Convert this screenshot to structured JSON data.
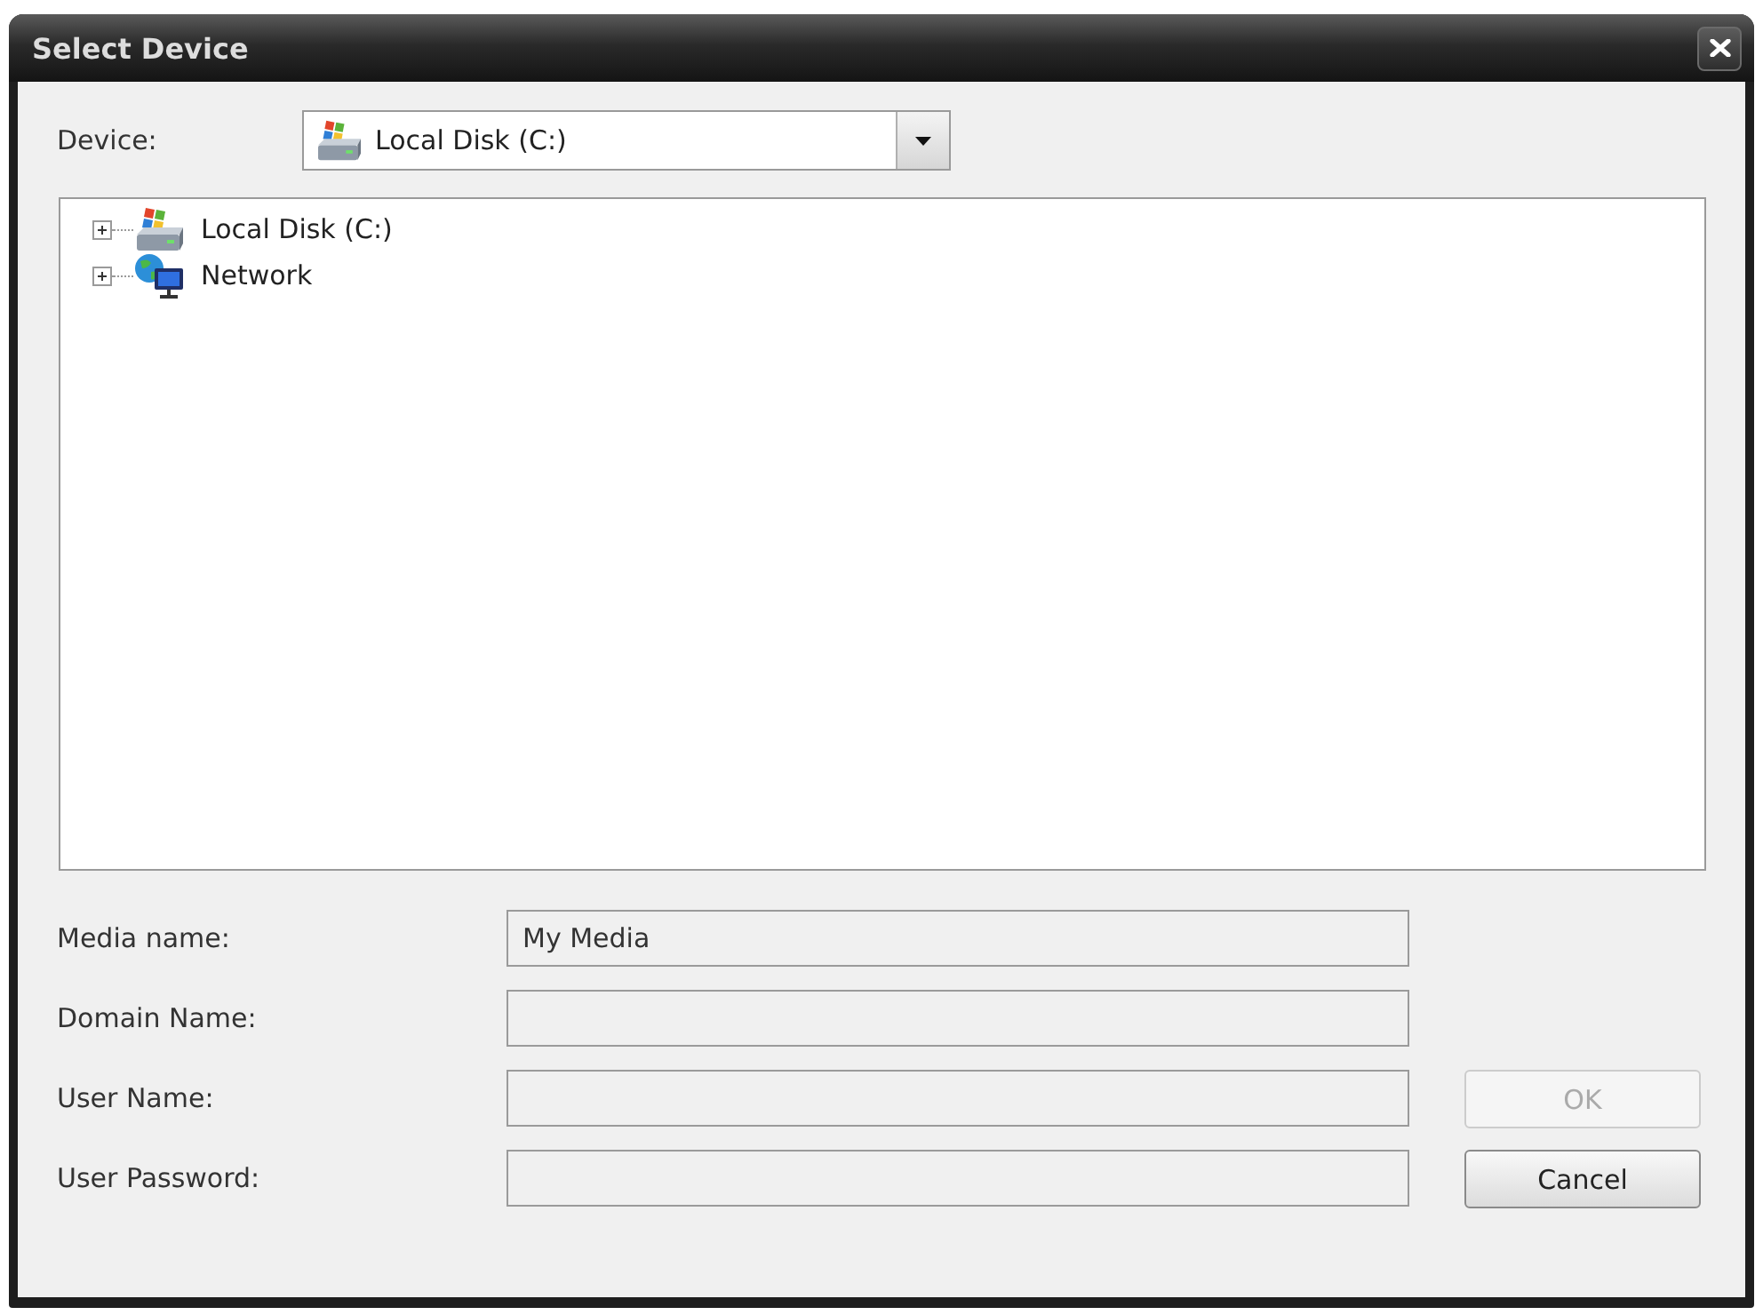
{
  "window": {
    "title": "Select Device"
  },
  "device": {
    "label": "Device:",
    "value": "Local Disk (C:)"
  },
  "tree": {
    "items": [
      {
        "label": "Local Disk (C:)",
        "kind": "drive",
        "expanded": false
      },
      {
        "label": "Network",
        "kind": "network",
        "expanded": false
      }
    ]
  },
  "fields": [
    {
      "label": "Media name:",
      "value": "My Media"
    },
    {
      "label": "Domain Name:"
    },
    {
      "label": "User Name:"
    },
    {
      "label": "User Password:"
    }
  ],
  "buttons": [
    {
      "label": "OK",
      "disabled": true
    },
    {
      "label": "Cancel",
      "disabled": false
    }
  ]
}
